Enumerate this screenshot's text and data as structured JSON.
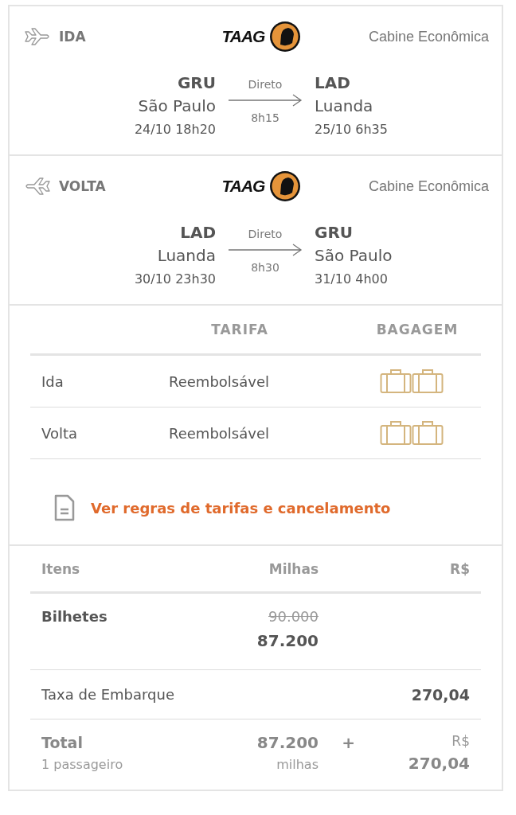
{
  "flights": [
    {
      "direction": "IDA",
      "kind": "outbound",
      "airline": "TAAG",
      "cabin": "Cabine Econômica",
      "from": {
        "code": "GRU",
        "city": "São Paulo",
        "time": "24/10 18h20"
      },
      "stops": "Direto",
      "duration": "8h15",
      "to": {
        "code": "LAD",
        "city": "Luanda",
        "time": "25/10 6h35"
      }
    },
    {
      "direction": "VOLTA",
      "kind": "return",
      "airline": "TAAG",
      "cabin": "Cabine Econômica",
      "from": {
        "code": "LAD",
        "city": "Luanda",
        "time": "30/10 23h30"
      },
      "stops": "Direto",
      "duration": "8h30",
      "to": {
        "code": "GRU",
        "city": "São Paulo",
        "time": "31/10 4h00"
      }
    }
  ],
  "fares": {
    "columns": [
      "TARIFA",
      "BAGAGEM"
    ],
    "rows": [
      {
        "leg": "Ida",
        "fare": "Reembolsável",
        "bags": [
          {
            "kind": "suitcase"
          },
          {
            "kind": "suitcase"
          }
        ]
      },
      {
        "leg": "Volta",
        "fare": "Reembolsável",
        "bags": [
          {
            "kind": "suitcase"
          },
          {
            "kind": "suitcase"
          }
        ]
      }
    ],
    "rules_link": "Ver regras de tarifas e cancelamento"
  },
  "prices": {
    "columns": [
      "Itens",
      "Milhas",
      "R$"
    ],
    "tickets": {
      "label": "Bilhetes",
      "old_miles": "90.000",
      "miles": "87.200"
    },
    "fee": {
      "label": "Taxa de Embarque",
      "amount": "270,04"
    },
    "total": {
      "label": "Total",
      "passengers": "1 passageiro",
      "miles": "87.200",
      "miles_unit": "milhas",
      "plus": "+",
      "currency": "R$",
      "amount": "270,04"
    }
  }
}
